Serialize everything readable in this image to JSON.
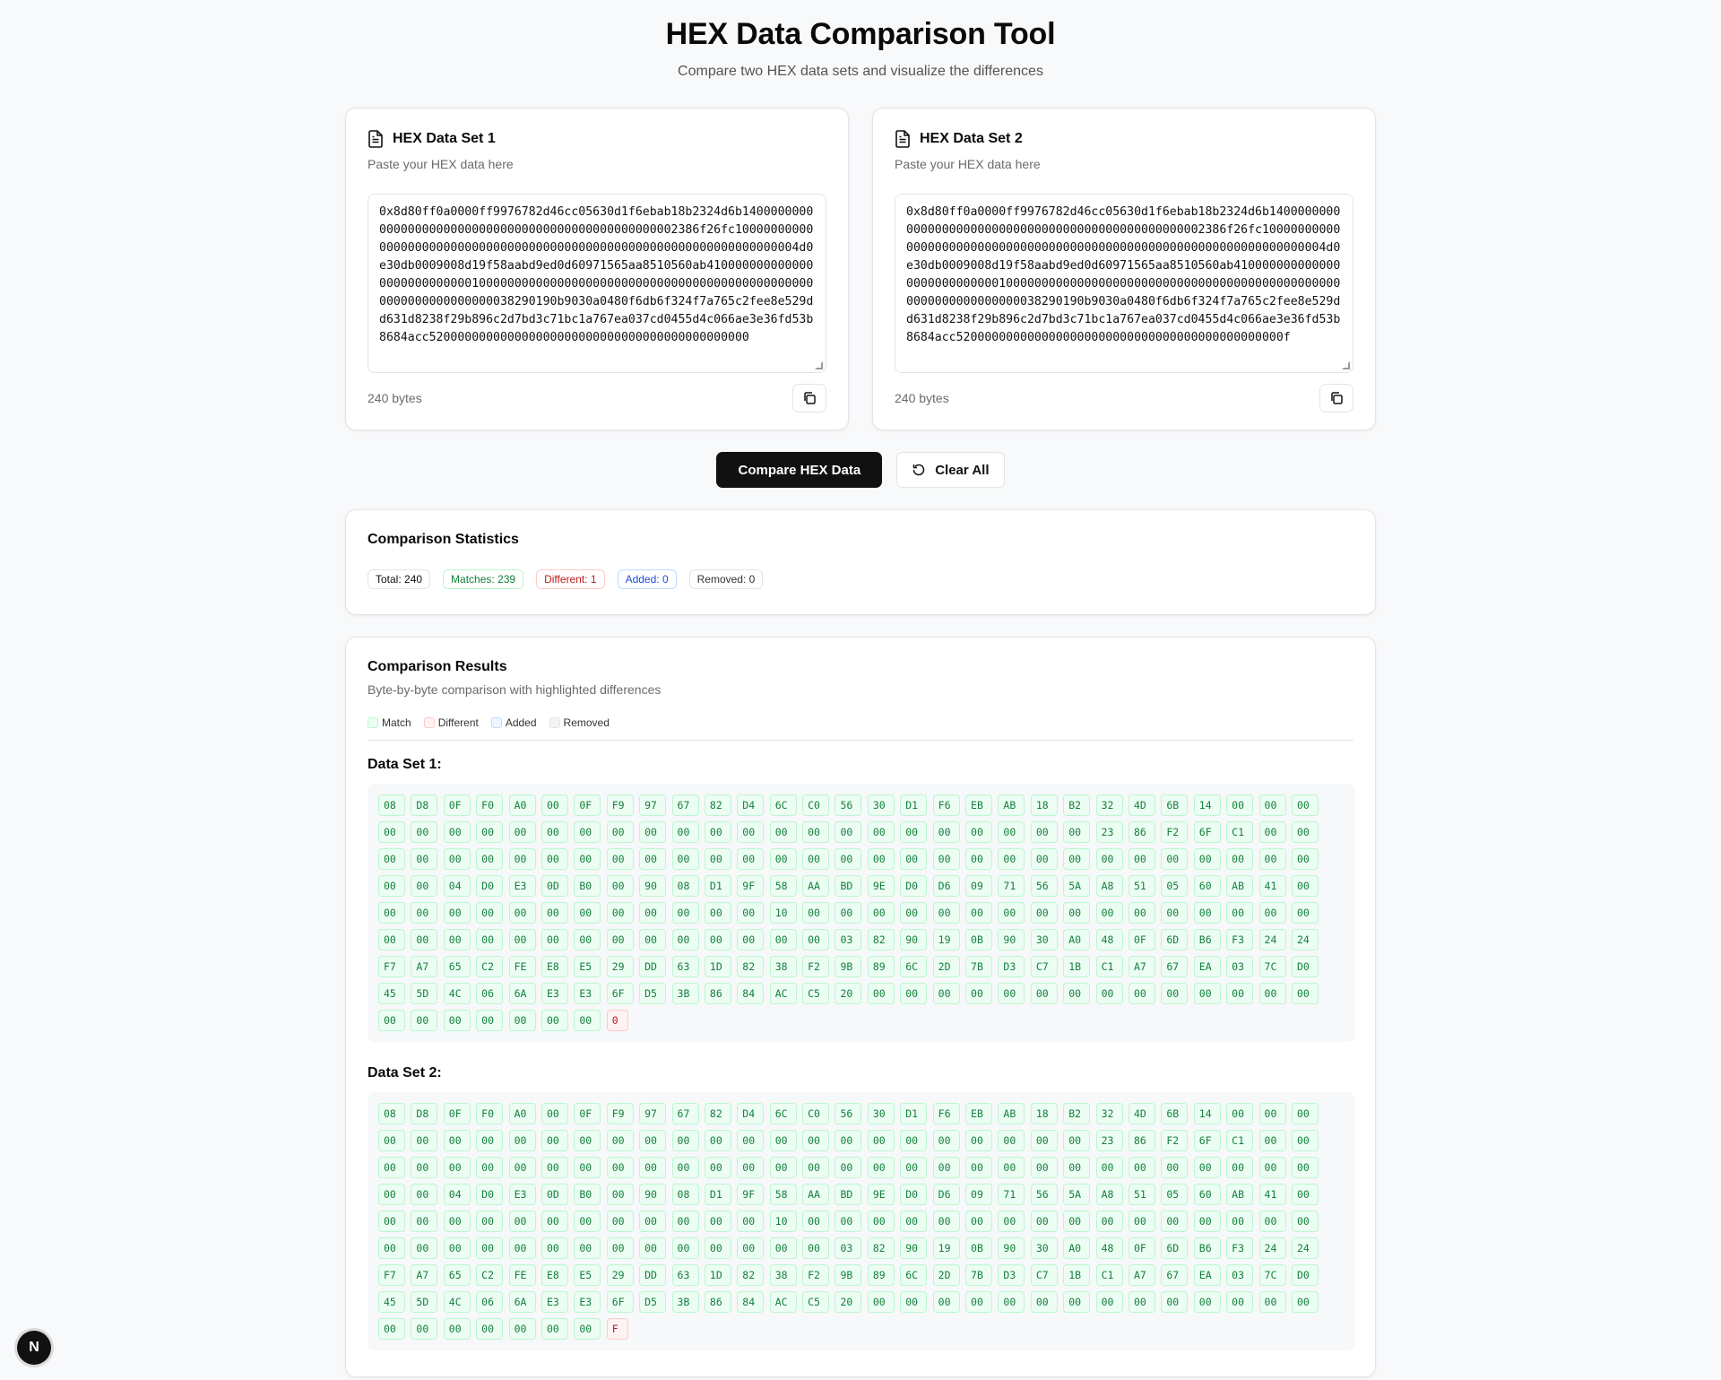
{
  "header": {
    "title": "HEX Data Comparison Tool",
    "subtitle": "Compare two HEX data sets and visualize the differences"
  },
  "input1": {
    "title": "HEX Data Set 1",
    "description": "Paste your HEX data here",
    "value": "0x8d80ff0a0000ff9976782d46cc05630d1f6ebab18b2324d6b1400000000000000000000000000000000000000000000000002386f26fc1000000000000000000000000000000000000000000000000000000000000000000004d0e30db0009008d19f58aabd9ed0d60971565aa8510560ab41000000000000000000000000001000000000000000000000000000000000000000000000000000000000000000038290190b9030a0480f6db6f324f7a765c2fee8e529dd631d8238f29b896c2d7bd3c71bc1a767ea037cd0455d4c066ae3e36fd53b8684acc520000000000000000000000000000000000000000000",
    "byte_count": "240 bytes"
  },
  "input2": {
    "title": "HEX Data Set 2",
    "description": "Paste your HEX data here",
    "value": "0x8d80ff0a0000ff9976782d46cc05630d1f6ebab18b2324d6b1400000000000000000000000000000000000000000000000002386f26fc1000000000000000000000000000000000000000000000000000000000000000000004d0e30db0009008d19f58aabd9ed0d60971565aa8510560ab41000000000000000000000000001000000000000000000000000000000000000000000000000000000000000000038290190b9030a0480f6db6f324f7a765c2fee8e529dd631d8238f29b896c2d7bd3c71bc1a767ea037cd0455d4c066ae3e36fd53b8684acc5200000000000000000000000000000000000000000000f",
    "byte_count": "240 bytes"
  },
  "actions": {
    "compare_label": "Compare HEX Data",
    "clear_label": "Clear All"
  },
  "stats": {
    "title": "Comparison Statistics",
    "total": "Total: 240",
    "matches": "Matches: 239",
    "different": "Different: 1",
    "added": "Added: 0",
    "removed": "Removed: 0"
  },
  "results": {
    "title": "Comparison Results",
    "subtitle": "Byte-by-byte comparison with highlighted differences",
    "legend": {
      "match": "Match",
      "different": "Different",
      "added": "Added",
      "removed": "Removed"
    },
    "set1_title": "Data Set 1:",
    "set2_title": "Data Set 2:",
    "set1_bytes": [
      "08",
      "D8",
      "0F",
      "F0",
      "A0",
      "00",
      "0F",
      "F9",
      "97",
      "67",
      "82",
      "D4",
      "6C",
      "C0",
      "56",
      "30",
      "D1",
      "F6",
      "EB",
      "AB",
      "18",
      "B2",
      "32",
      "4D",
      "6B",
      "14",
      "00",
      "00",
      "00",
      "00",
      "00",
      "00",
      "00",
      "00",
      "00",
      "00",
      "00",
      "00",
      "00",
      "00",
      "00",
      "00",
      "00",
      "00",
      "00",
      "00",
      "00",
      "00",
      "00",
      "00",
      "00",
      "23",
      "86",
      "F2",
      "6F",
      "C1",
      "00",
      "00",
      "00",
      "00",
      "00",
      "00",
      "00",
      "00",
      "00",
      "00",
      "00",
      "00",
      "00",
      "00",
      "00",
      "00",
      "00",
      "00",
      "00",
      "00",
      "00",
      "00",
      "00",
      "00",
      "00",
      "00",
      "00",
      "00",
      "00",
      "00",
      "00",
      "00",
      "00",
      "04",
      "D0",
      "E3",
      "0D",
      "B0",
      "00",
      "90",
      "08",
      "D1",
      "9F",
      "58",
      "AA",
      "BD",
      "9E",
      "D0",
      "D6",
      "09",
      "71",
      "56",
      "5A",
      "A8",
      "51",
      "05",
      "60",
      "AB",
      "41",
      "00",
      "00",
      "00",
      "00",
      "00",
      "00",
      "00",
      "00",
      "00",
      "00",
      "00",
      "00",
      "00",
      "10",
      "00",
      "00",
      "00",
      "00",
      "00",
      "00",
      "00",
      "00",
      "00",
      "00",
      "00",
      "00",
      "00",
      "00",
      "00",
      "00",
      "00",
      "00",
      "00",
      "00",
      "00",
      "00",
      "00",
      "00",
      "00",
      "00",
      "00",
      "00",
      "00",
      "00",
      "03",
      "82",
      "90",
      "19",
      "0B",
      "90",
      "30",
      "A0",
      "48",
      "0F",
      "6D",
      "B6",
      "F3",
      "24",
      "24",
      "F7",
      "A7",
      "65",
      "C2",
      "FE",
      "E8",
      "E5",
      "29",
      "DD",
      "63",
      "1D",
      "82",
      "38",
      "F2",
      "9B",
      "89",
      "6C",
      "2D",
      "7B",
      "D3",
      "C7",
      "1B",
      "C1",
      "A7",
      "67",
      "EA",
      "03",
      "7C",
      "D0",
      "45",
      "5D",
      "4C",
      "06",
      "6A",
      "E3",
      "E3",
      "6F",
      "D5",
      "3B",
      "86",
      "84",
      "AC",
      "C5",
      "20",
      "00",
      "00",
      "00",
      "00",
      "00",
      "00",
      "00",
      "00",
      "00",
      "00",
      "00",
      "00",
      "00",
      "00",
      "00",
      "00",
      "00",
      "00",
      "00",
      "00",
      "00",
      "0"
    ],
    "set2_bytes": [
      "08",
      "D8",
      "0F",
      "F0",
      "A0",
      "00",
      "0F",
      "F9",
      "97",
      "67",
      "82",
      "D4",
      "6C",
      "C0",
      "56",
      "30",
      "D1",
      "F6",
      "EB",
      "AB",
      "18",
      "B2",
      "32",
      "4D",
      "6B",
      "14",
      "00",
      "00",
      "00",
      "00",
      "00",
      "00",
      "00",
      "00",
      "00",
      "00",
      "00",
      "00",
      "00",
      "00",
      "00",
      "00",
      "00",
      "00",
      "00",
      "00",
      "00",
      "00",
      "00",
      "00",
      "00",
      "23",
      "86",
      "F2",
      "6F",
      "C1",
      "00",
      "00",
      "00",
      "00",
      "00",
      "00",
      "00",
      "00",
      "00",
      "00",
      "00",
      "00",
      "00",
      "00",
      "00",
      "00",
      "00",
      "00",
      "00",
      "00",
      "00",
      "00",
      "00",
      "00",
      "00",
      "00",
      "00",
      "00",
      "00",
      "00",
      "00",
      "00",
      "00",
      "04",
      "D0",
      "E3",
      "0D",
      "B0",
      "00",
      "90",
      "08",
      "D1",
      "9F",
      "58",
      "AA",
      "BD",
      "9E",
      "D0",
      "D6",
      "09",
      "71",
      "56",
      "5A",
      "A8",
      "51",
      "05",
      "60",
      "AB",
      "41",
      "00",
      "00",
      "00",
      "00",
      "00",
      "00",
      "00",
      "00",
      "00",
      "00",
      "00",
      "00",
      "00",
      "10",
      "00",
      "00",
      "00",
      "00",
      "00",
      "00",
      "00",
      "00",
      "00",
      "00",
      "00",
      "00",
      "00",
      "00",
      "00",
      "00",
      "00",
      "00",
      "00",
      "00",
      "00",
      "00",
      "00",
      "00",
      "00",
      "00",
      "00",
      "00",
      "00",
      "00",
      "03",
      "82",
      "90",
      "19",
      "0B",
      "90",
      "30",
      "A0",
      "48",
      "0F",
      "6D",
      "B6",
      "F3",
      "24",
      "24",
      "F7",
      "A7",
      "65",
      "C2",
      "FE",
      "E8",
      "E5",
      "29",
      "DD",
      "63",
      "1D",
      "82",
      "38",
      "F2",
      "9B",
      "89",
      "6C",
      "2D",
      "7B",
      "D3",
      "C7",
      "1B",
      "C1",
      "A7",
      "67",
      "EA",
      "03",
      "7C",
      "D0",
      "45",
      "5D",
      "4C",
      "06",
      "6A",
      "E3",
      "E3",
      "6F",
      "D5",
      "3B",
      "86",
      "84",
      "AC",
      "C5",
      "20",
      "00",
      "00",
      "00",
      "00",
      "00",
      "00",
      "00",
      "00",
      "00",
      "00",
      "00",
      "00",
      "00",
      "00",
      "00",
      "00",
      "00",
      "00",
      "00",
      "00",
      "00",
      "F"
    ],
    "diff_index": 239
  },
  "overlay": {
    "badge_letter": "N"
  },
  "colors": {
    "match_bg": "#ecfdf3",
    "match_text": "#15803d",
    "diff_bg": "#fef2f2",
    "diff_text": "#b91c1c",
    "added_text": "#1d4ed8",
    "primary_button": "#111111"
  }
}
